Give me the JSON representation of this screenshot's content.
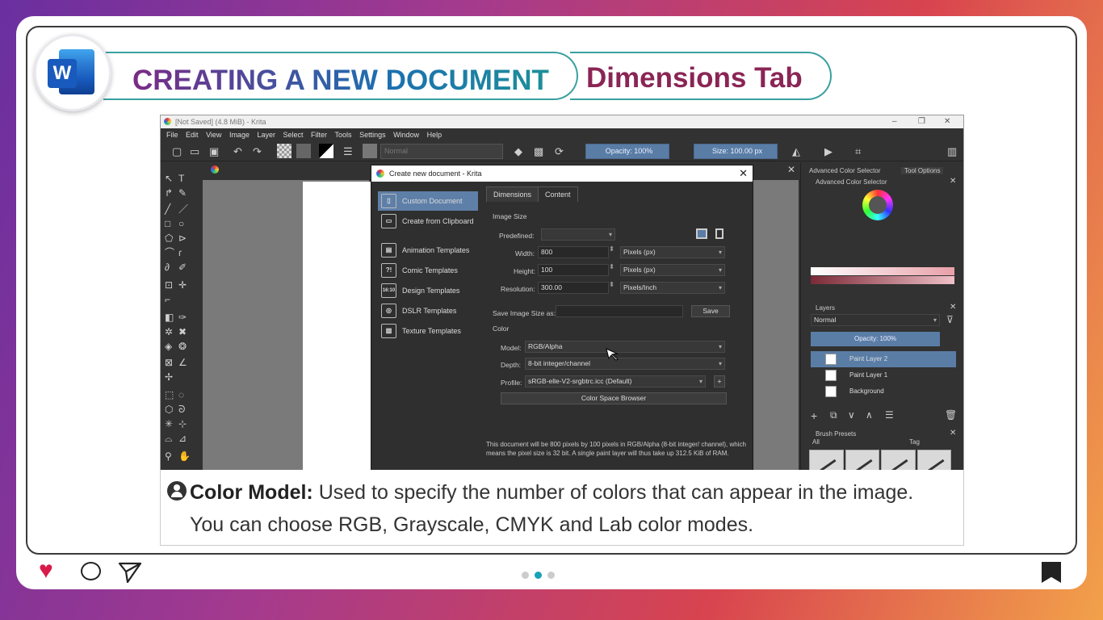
{
  "slide": {
    "title_main": "CREATING A NEW DOCUMENT",
    "title_tab": "Dimensions Tab",
    "logo_letter": "W"
  },
  "krita": {
    "window_title": "[Not Saved]  (4.8 MiB)  - Krita",
    "menu": [
      "File",
      "Edit",
      "View",
      "Image",
      "Layer",
      "Select",
      "Filter",
      "Tools",
      "Settings",
      "Window",
      "Help"
    ],
    "toolbar": {
      "blend_mode": "Normal",
      "opacity": "Opacity: 100%",
      "size": "Size: 100.00 px"
    },
    "dialog": {
      "title": "Create new document - Krita",
      "sidebar": [
        {
          "label": "Custom Document",
          "icon": "document-icon"
        },
        {
          "label": "Create from Clipboard",
          "icon": "clipboard-icon"
        },
        {
          "label": "Animation Templates",
          "icon": "film-icon"
        },
        {
          "label": "Comic Templates",
          "icon": "speech-bubble-icon",
          "glyph": "?!"
        },
        {
          "label": "Design Templates",
          "icon": "ratio-icon",
          "glyph": "16:10"
        },
        {
          "label": "DSLR Templates",
          "icon": "camera-icon"
        },
        {
          "label": "Texture Templates",
          "icon": "texture-icon"
        }
      ],
      "tabs": [
        "Dimensions",
        "Content"
      ],
      "image_size_header": "Image Size",
      "predefined_label": "Predefined:",
      "width_label": "Width:",
      "width": "800",
      "width_unit": "Pixels (px)",
      "height_label": "Height:",
      "height": "100",
      "height_unit": "Pixels (px)",
      "resolution_label": "Resolution:",
      "resolution": "300.00",
      "resolution_unit": "Pixels/Inch",
      "save_size_label": "Save Image Size as:",
      "save_button": "Save",
      "color_header": "Color",
      "model_label": "Model:",
      "model": "RGB/Alpha",
      "depth_label": "Depth:",
      "depth": "8-bit integer/channel",
      "profile_label": "Profile:",
      "profile": "sRGB-elle-V2-srgbtrc.icc (Default)",
      "color_space_button": "Color Space Browser",
      "description": "This document will be 800 pixels by 100 pixels in RGB/Alpha (8-bit integer/ channel), which means the pixel size is 32 bit. A single paint layer will thus take up 312.5 KiB of RAM."
    },
    "right_panel": {
      "tabs": [
        "Advanced Color Selector",
        "Tool Options"
      ],
      "color_selector_title": "Advanced Color Selector",
      "layers_title": "Layers",
      "layers_blend": "Normal",
      "layers_opacity": "Opacity:  100%",
      "layers": [
        "Paint Layer 2",
        "Paint Layer 1",
        "Background"
      ],
      "brush_presets_title": "Brush Presets",
      "brush_filter": "All",
      "brush_tag": "Tag"
    }
  },
  "caption": {
    "term": "Color Model:",
    "text": " Used to specify the number of colors that can appear in the image. You can choose RGB, Grayscale, CMYK and Lab color modes."
  },
  "colors": {
    "accent": "#1aa0b8",
    "heart": "#d81b4a",
    "title_tab": "#8a2555",
    "selection": "#5e7fa8"
  }
}
